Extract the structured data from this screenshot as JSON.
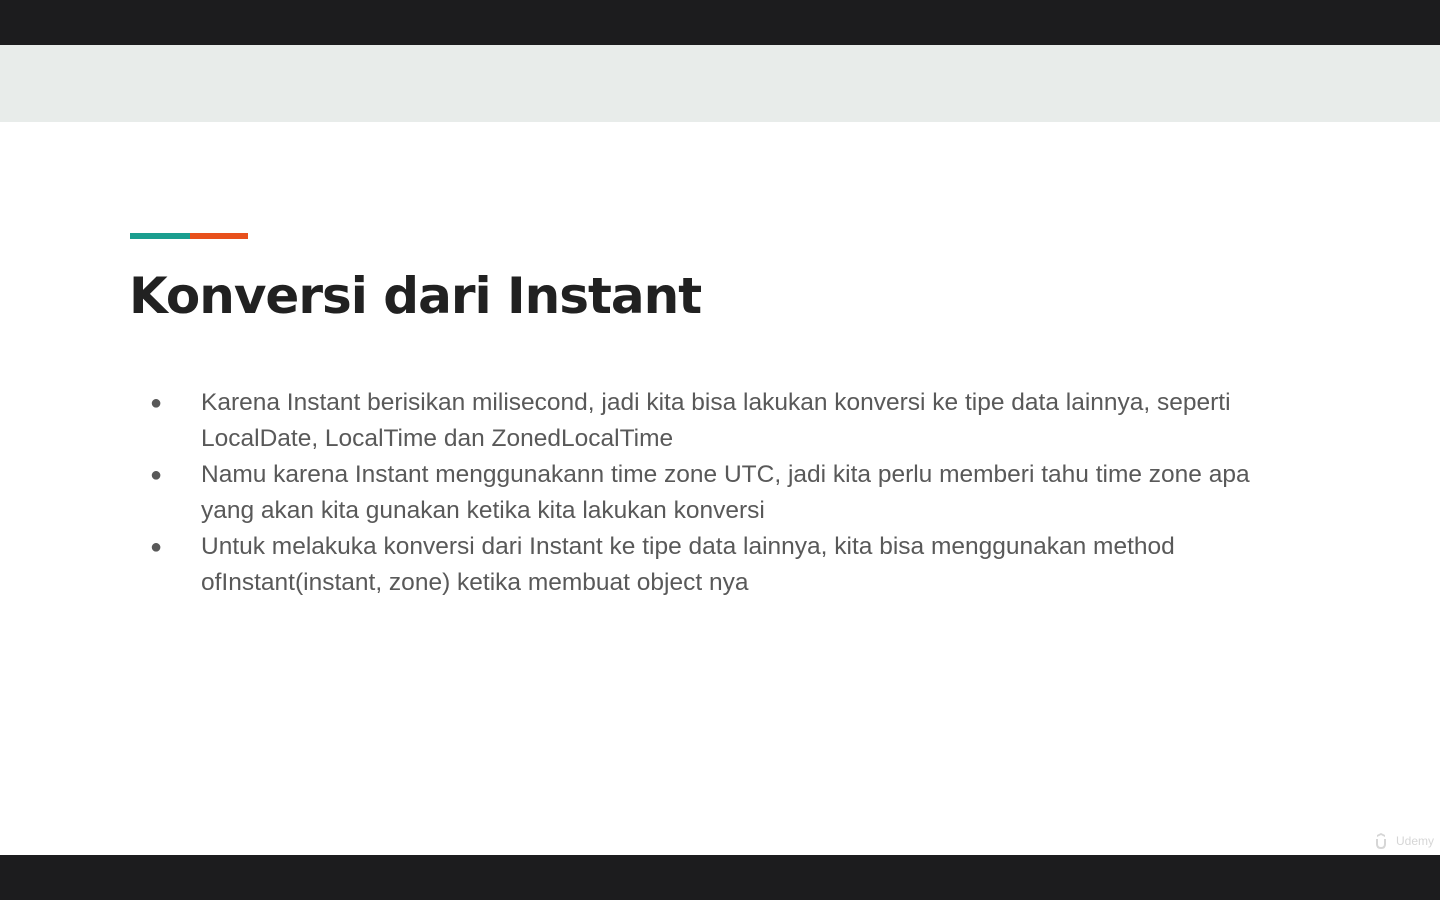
{
  "slide": {
    "title": "Konversi dari Instant",
    "accent_colors": {
      "teal": "#1a9e8f",
      "orange": "#e8501c"
    },
    "bullets": [
      "Karena Instant berisikan milisecond, jadi kita bisa lakukan konversi ke tipe data lainnya, seperti LocalDate, LocalTime dan ZonedLocalTime",
      "Namu karena Instant menggunakann time zone UTC, jadi kita perlu memberi tahu time zone apa yang akan kita gunakan ketika kita lakukan konversi",
      "Untuk melakuka konversi dari Instant ke tipe data lainnya, kita bisa menggunakan method ofInstant(instant, zone) ketika membuat object nya"
    ],
    "bullet_marker": "●",
    "watermark": {
      "icon": "udemy-logo-icon",
      "text": "Udemy"
    }
  }
}
